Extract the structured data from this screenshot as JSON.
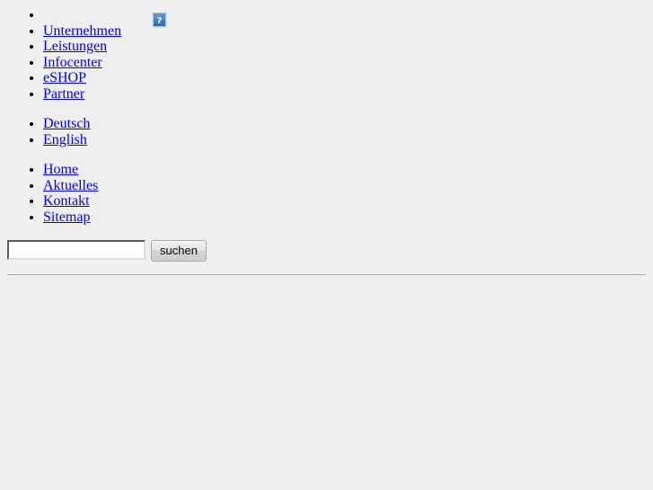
{
  "page": {
    "background_color": "#efefef",
    "link_color": "#0000ee",
    "text_color": "#000000"
  },
  "logo": {
    "icon": "broken-image-icon",
    "alt": "",
    "tooltip": "?"
  },
  "main_nav": {
    "items": [
      {
        "label": "",
        "is_logo": true
      },
      {
        "label": "Unternehmen"
      },
      {
        "label": "Leistungen"
      },
      {
        "label": "Infocenter"
      },
      {
        "label": "eSHOP"
      },
      {
        "label": "Partner"
      }
    ]
  },
  "language_nav": {
    "items": [
      {
        "label": "Deutsch"
      },
      {
        "label": "English"
      }
    ]
  },
  "meta_nav": {
    "items": [
      {
        "label": "Home"
      },
      {
        "label": "Aktuelles"
      },
      {
        "label": "Kontakt"
      },
      {
        "label": "Sitemap"
      }
    ]
  },
  "search": {
    "value": "",
    "placeholder": "",
    "button_label": "suchen"
  }
}
